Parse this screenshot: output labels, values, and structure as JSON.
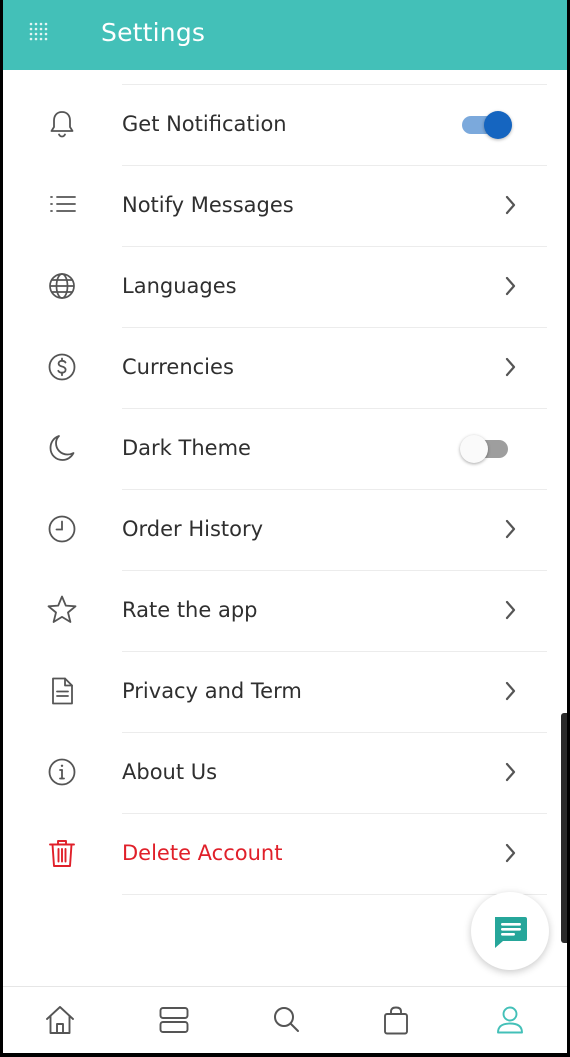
{
  "header": {
    "title": "Settings",
    "menu_icon": "grid-dots-icon",
    "background_color": "#43c0b8"
  },
  "settings": {
    "items": [
      {
        "label": "Get Notification",
        "icon": "bell-icon",
        "control": "toggle",
        "toggle_on": true
      },
      {
        "label": "Notify Messages",
        "icon": "list-icon",
        "control": "chevron"
      },
      {
        "label": "Languages",
        "icon": "globe-icon",
        "control": "chevron"
      },
      {
        "label": "Currencies",
        "icon": "dollar-icon",
        "control": "chevron"
      },
      {
        "label": "Dark Theme",
        "icon": "moon-icon",
        "control": "toggle",
        "toggle_on": false
      },
      {
        "label": "Order History",
        "icon": "clock-icon",
        "control": "chevron"
      },
      {
        "label": "Rate the app",
        "icon": "star-icon",
        "control": "chevron"
      },
      {
        "label": "Privacy and Term",
        "icon": "document-icon",
        "control": "chevron"
      },
      {
        "label": "About Us",
        "icon": "info-icon",
        "control": "chevron"
      },
      {
        "label": "Delete Account",
        "icon": "trash-icon",
        "control": "chevron",
        "danger": true
      }
    ]
  },
  "colors": {
    "accent": "#43c0b8",
    "toggle_on_knob": "#1565c0",
    "danger": "#e0202a",
    "icon": "#555555"
  },
  "fab": {
    "icon": "chat-icon"
  },
  "bottom_nav": {
    "items": [
      {
        "icon": "home-icon",
        "active": false
      },
      {
        "icon": "categories-icon",
        "active": false
      },
      {
        "icon": "search-icon",
        "active": false
      },
      {
        "icon": "bag-icon",
        "active": false
      },
      {
        "icon": "profile-icon",
        "active": true
      }
    ]
  }
}
